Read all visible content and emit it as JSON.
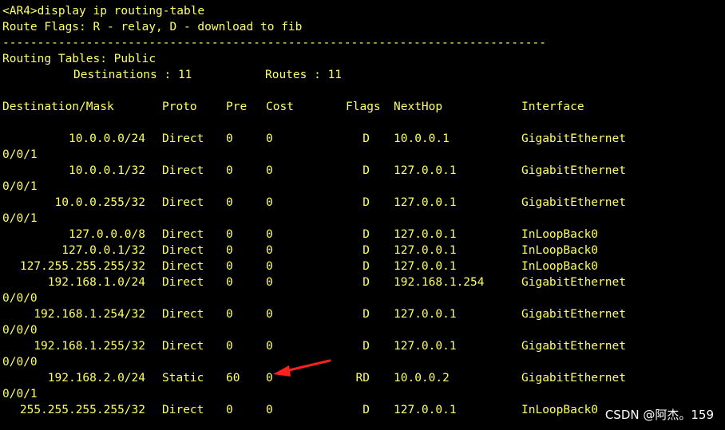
{
  "terminal": {
    "command_line": "<AR4>display ip routing-table",
    "route_flags": "Route Flags: R - relay, D - download to fib",
    "separator": "------------------------------------------------------------------------------",
    "routing_tables": "Routing Tables: Public",
    "destinations_label": "Destinations : 11",
    "routes_label": "Routes : 11"
  },
  "table": {
    "headers": {
      "dest": "Destination/Mask",
      "proto": "Proto",
      "pre": "Pre",
      "cost": "Cost",
      "flags": "Flags",
      "nexthop": "NextHop",
      "iface": "Interface"
    },
    "rows": [
      {
        "dest": "10.0.0.0/24",
        "proto": "Direct",
        "pre": "0",
        "cost": "0",
        "flags": "D",
        "nexthop": "10.0.0.1",
        "iface": "GigabitEthernet",
        "cont": "0/0/1"
      },
      {
        "dest": "10.0.0.1/32",
        "proto": "Direct",
        "pre": "0",
        "cost": "0",
        "flags": "D",
        "nexthop": "127.0.0.1",
        "iface": "GigabitEthernet",
        "cont": "0/0/1"
      },
      {
        "dest": "10.0.0.255/32",
        "proto": "Direct",
        "pre": "0",
        "cost": "0",
        "flags": "D",
        "nexthop": "127.0.0.1",
        "iface": "GigabitEthernet",
        "cont": "0/0/1"
      },
      {
        "dest": "127.0.0.0/8",
        "proto": "Direct",
        "pre": "0",
        "cost": "0",
        "flags": "D",
        "nexthop": "127.0.0.1",
        "iface": "InLoopBack0"
      },
      {
        "dest": "127.0.0.1/32",
        "proto": "Direct",
        "pre": "0",
        "cost": "0",
        "flags": "D",
        "nexthop": "127.0.0.1",
        "iface": "InLoopBack0"
      },
      {
        "dest": "127.255.255.255/32",
        "proto": "Direct",
        "pre": "0",
        "cost": "0",
        "flags": "D",
        "nexthop": "127.0.0.1",
        "iface": "InLoopBack0"
      },
      {
        "dest": "192.168.1.0/24",
        "proto": "Direct",
        "pre": "0",
        "cost": "0",
        "flags": "D",
        "nexthop": "192.168.1.254",
        "iface": "GigabitEthernet",
        "cont": "0/0/0"
      },
      {
        "dest": "192.168.1.254/32",
        "proto": "Direct",
        "pre": "0",
        "cost": "0",
        "flags": "D",
        "nexthop": "127.0.0.1",
        "iface": "GigabitEthernet",
        "cont": "0/0/0"
      },
      {
        "dest": "192.168.1.255/32",
        "proto": "Direct",
        "pre": "0",
        "cost": "0",
        "flags": "D",
        "nexthop": "127.0.0.1",
        "iface": "GigabitEthernet",
        "cont": "0/0/0"
      },
      {
        "dest": "192.168.2.0/24",
        "proto": "Static",
        "pre": "60",
        "cost": "0",
        "flags": "RD",
        "nexthop": "10.0.0.2",
        "iface": "GigabitEthernet",
        "cont": "0/0/1"
      },
      {
        "dest": "255.255.255.255/32",
        "proto": "Direct",
        "pre": "0",
        "cost": "0",
        "flags": "D",
        "nexthop": "127.0.0.1",
        "iface": "InLoopBack0"
      }
    ]
  },
  "annotation": {
    "arrow_color": "#ff2020",
    "arrow_icon": "red-arrow-icon"
  },
  "watermark": "CSDN @阿杰。159",
  "colors": {
    "background": "#000000",
    "text": "#ffff66",
    "watermark": "#ffffff"
  }
}
